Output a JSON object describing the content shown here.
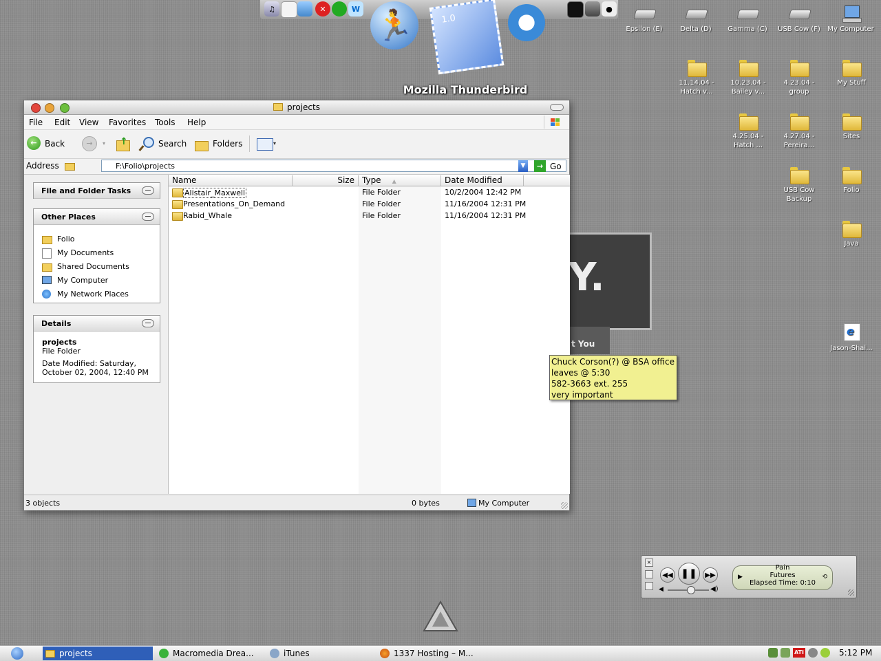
{
  "dock": {
    "caption": "Mozilla Thunderbird",
    "icons": [
      "itunes-icon",
      "ipod-icon",
      "iphoto-icon",
      "stop-icon",
      "dashboard-icon",
      "wordbook-icon",
      "aim-icon",
      "mail-icon",
      "safari-icon",
      "terminal-icon",
      "trash-icon",
      "apple-icon"
    ],
    "mail_version": "1.0"
  },
  "desktop": {
    "drives": [
      {
        "label": "Epsilon (E)"
      },
      {
        "label": "Delta (D)"
      },
      {
        "label": "Gamma (C)"
      },
      {
        "label": "USB Cow (F)"
      },
      {
        "label": "My Computer"
      }
    ],
    "folders": [
      {
        "label": "11.14.04 - Hatch v..."
      },
      {
        "label": "10.23.04 - Bailey v..."
      },
      {
        "label": "4.23.04 - group"
      },
      {
        "label": "My Stuff"
      },
      {
        "label": "4.25.04 - Hatch ..."
      },
      {
        "label": "4.27.04 - Pereira..."
      },
      {
        "label": "Sites"
      },
      {
        "label": "USB Cow Backup"
      },
      {
        "label": "Folio"
      },
      {
        "label": "Java"
      }
    ],
    "shortcut": {
      "label": "Jason-Shai..."
    }
  },
  "window": {
    "title": "projects",
    "menus": [
      "File",
      "Edit",
      "View",
      "Favorites",
      "Tools",
      "Help"
    ],
    "toolbar": {
      "back": "Back",
      "search": "Search",
      "folders": "Folders"
    },
    "address": {
      "label": "Address",
      "value": "F:\\Folio\\projects",
      "go": "Go"
    },
    "tasks": {
      "file_folder_tasks": "File and Folder Tasks",
      "other_places": "Other Places",
      "places": [
        "Folio",
        "My Documents",
        "Shared Documents",
        "My Computer",
        "My Network Places"
      ],
      "details": "Details",
      "detail_name": "projects",
      "detail_type": "File Folder",
      "detail_modified_1": "Date Modified: Saturday,",
      "detail_modified_2": "October 02, 2004, 12:40 PM"
    },
    "columns": {
      "name": "Name",
      "size": "Size",
      "type": "Type",
      "date": "Date Modified"
    },
    "files": [
      {
        "name": "Alistair_Maxwell",
        "size": "",
        "type": "File Folder",
        "date": "10/2/2004 12:42 PM"
      },
      {
        "name": "Presentations_On_Demand",
        "size": "",
        "type": "File Folder",
        "date": "11/16/2004 12:31 PM"
      },
      {
        "name": "Rabid_Whale",
        "size": "",
        "type": "File Folder",
        "date": "11/16/2004 12:31 PM"
      }
    ],
    "status": {
      "objects": "3 objects",
      "bytes": "0 bytes",
      "zone": "My Computer"
    }
  },
  "background_logo": {
    "text": "Y.",
    "tagline": "t You"
  },
  "sticky": {
    "lines": [
      "Chuck Corson(?) @ BSA office",
      "leaves @ 5:30",
      "582-3663 ext. 255",
      "very important"
    ]
  },
  "itunes": {
    "track_line_1": "Pain",
    "track_line_2": "Futures",
    "elapsed": "Elapsed Time: 0:10",
    "volume_fraction": 0.55
  },
  "taskbar": {
    "tasks": [
      {
        "label": "projects",
        "active": true
      },
      {
        "label": "Macromedia Drea..."
      },
      {
        "label": "iTunes"
      },
      {
        "label": "1337 Hosting – M..."
      }
    ],
    "clock": "5:12 PM"
  },
  "colors": {
    "accent_active_task": "#2f5fb8",
    "sticky": "#f1f091",
    "desktop": "#8e8e8e"
  }
}
